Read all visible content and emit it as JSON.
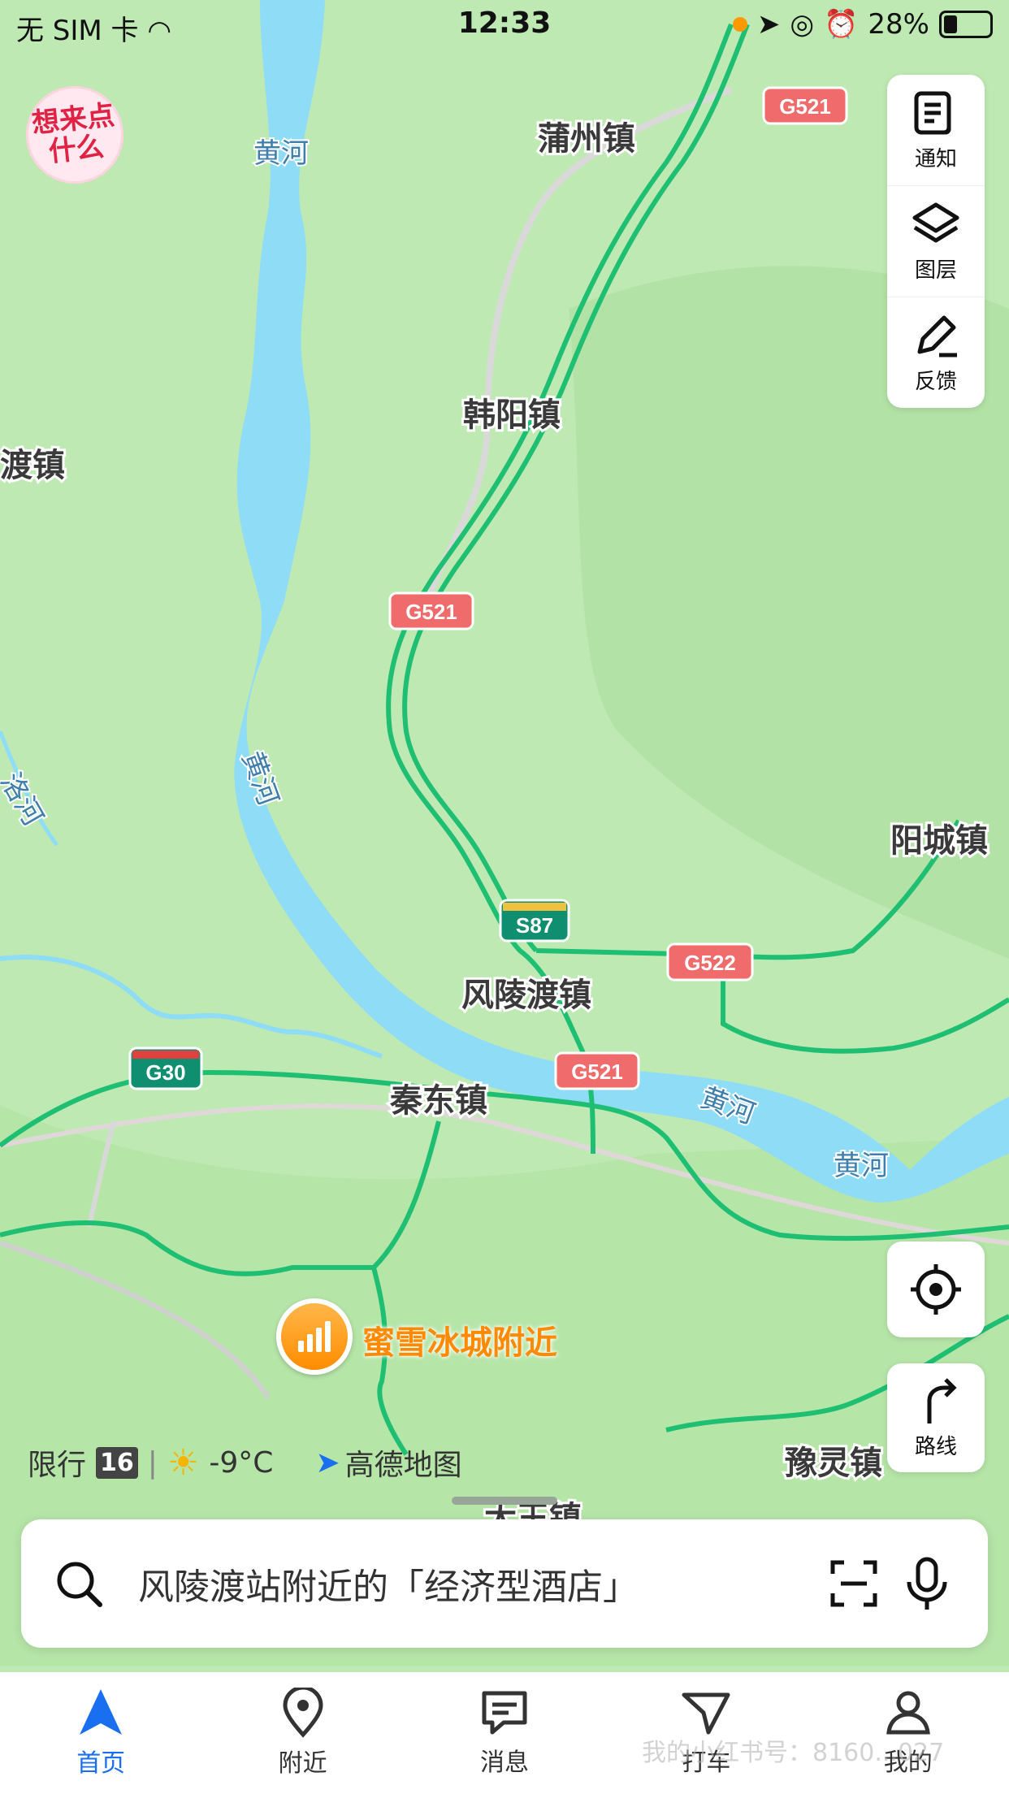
{
  "status_bar": {
    "carrier": "无 SIM 卡",
    "time": "12:33",
    "battery": "28%"
  },
  "logo_badge": "想来点\n什么",
  "side_panel": [
    {
      "label": "通知",
      "icon": "notification-icon"
    },
    {
      "label": "图层",
      "icon": "layers-icon"
    },
    {
      "label": "反馈",
      "icon": "feedback-pen-icon"
    }
  ],
  "route_button": {
    "label": "路线"
  },
  "map": {
    "places": [
      "蒲州镇",
      "韩阳镇",
      "渡镇",
      "阳城镇",
      "风陵渡镇",
      "秦东镇",
      "豫灵镇",
      "大王镇"
    ],
    "rivers": [
      "黄河",
      "黄河",
      "黄河",
      "黄河",
      "洛河"
    ],
    "shields": [
      "G521",
      "G521",
      "G521",
      "S87",
      "G522",
      "G30"
    ],
    "current_location": "蜜雪冰城附近"
  },
  "info": {
    "restriction_label": "限行",
    "restriction_digits": "16",
    "temperature": "-9°C",
    "brand": "高德地图"
  },
  "search": {
    "placeholder": "风陵渡站附近的「经济型酒店」"
  },
  "tabs": [
    {
      "label": "首页",
      "active": true
    },
    {
      "label": "附近"
    },
    {
      "label": "消息"
    },
    {
      "label": "打车"
    },
    {
      "label": "我的"
    }
  ],
  "watermark": "我的小红书号：8160...027",
  "colors": {
    "map_bg": "#bfe9b3",
    "river": "#8fdcf6",
    "road": "#1fbf73",
    "accent": "#1a6ff0"
  }
}
